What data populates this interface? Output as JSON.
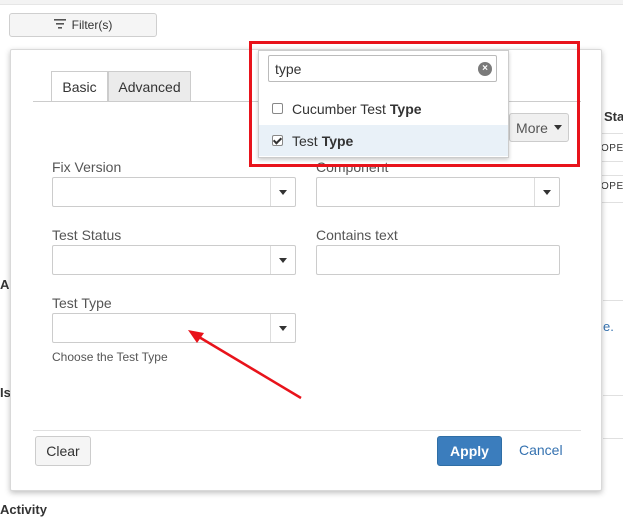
{
  "toolbar": {
    "filter_button_label": "Filter(s)",
    "filter_icon": "filter-icon"
  },
  "background": {
    "col_header_partial": "Sta",
    "status_partial_1": "OPE",
    "status_partial_2": "OPE",
    "link_partial": "e.",
    "left_frag_1": "A",
    "left_frag_2": "Is",
    "bottom_frag": "Activity"
  },
  "dialog": {
    "tabs": [
      {
        "label": "Basic",
        "active": true
      },
      {
        "label": "Advanced",
        "active": false
      }
    ],
    "more_button_label": "More",
    "fields": {
      "fix_version": {
        "label": "Fix Version",
        "value": ""
      },
      "component": {
        "label": "Component",
        "value": ""
      },
      "test_status": {
        "label": "Test Status",
        "value": ""
      },
      "contains_text": {
        "label": "Contains text",
        "value": ""
      },
      "test_type": {
        "label": "Test Type",
        "value": "",
        "hint": "Choose the Test Type"
      }
    },
    "buttons": {
      "clear": "Clear",
      "apply": "Apply",
      "cancel": "Cancel"
    }
  },
  "dropdown": {
    "search_value": "type",
    "options": [
      {
        "prefix": "Cucumber Test",
        "match": "Type",
        "checked": false
      },
      {
        "prefix": "Test",
        "match": "Type",
        "checked": true
      }
    ]
  },
  "colors": {
    "primary": "#3b7dbd",
    "link": "#3572b0",
    "highlight_border": "#e8131b",
    "option_hover": "#e9f1f8"
  }
}
